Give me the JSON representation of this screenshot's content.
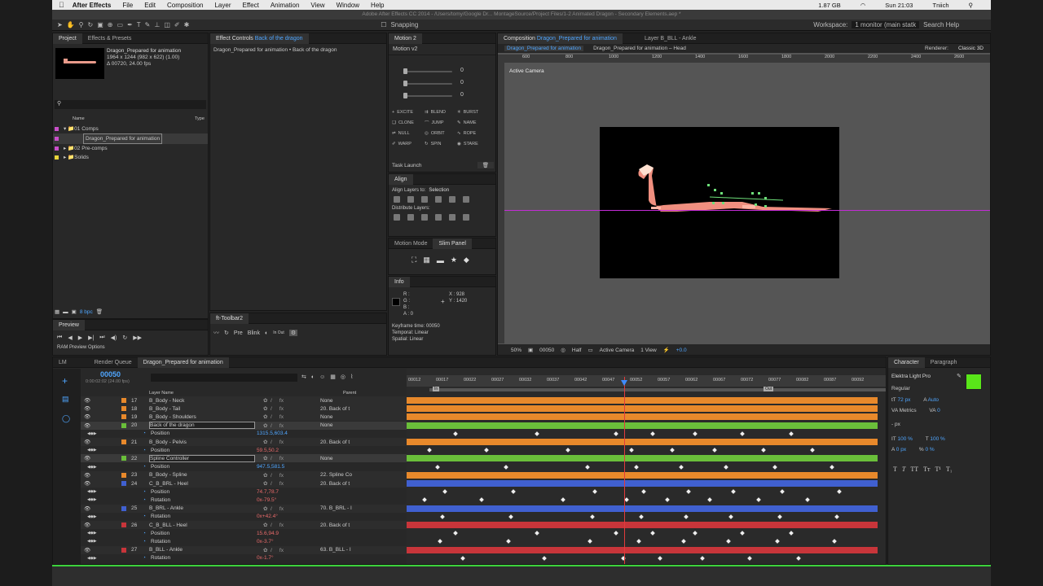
{
  "menubar": {
    "app": "After Effects",
    "items": [
      "File",
      "Edit",
      "Composition",
      "Layer",
      "Effect",
      "Animation",
      "View",
      "Window",
      "Help"
    ],
    "memory": "1.87 GB",
    "clock": "Sun 21:03",
    "user": "Tniich"
  },
  "window_title": "Adobe After Effects CC 2014 - /Users/tomy/Google Dr... MontageSource/Project Files/1-2 Animated Dragon - Secondary Elements.aep *",
  "toolbar": {
    "snapping": "Snapping",
    "workspace_label": "Workspace:",
    "workspace_value": "1 monitor (main statk",
    "search_help": "Search Help"
  },
  "project": {
    "tab1": "Project",
    "tab2": "Effects & Presets",
    "comp_name": "Dragon_Prepared for animation",
    "comp_dims": "1964 x 1244 (982 x 622) (1.00)",
    "comp_dur": "Δ 00720, 24.00 fps",
    "col_name": "Name",
    "col_type": "Type",
    "items": [
      "01 Comps",
      "Dragon_Prepared for animation",
      "02 Pre-comps",
      "Solids"
    ],
    "bpc": "8 bpc"
  },
  "effect_controls": {
    "label": "Effect Controls",
    "layer": "Back of the dragon",
    "path": "Dragon_Prepared for animation • Back of the dragon"
  },
  "motion": {
    "tab": "Motion 2",
    "version": "Motion v2",
    "vals": [
      "0",
      "0",
      "0"
    ],
    "buttons": [
      "EXCITE",
      "BLEND",
      "BURST",
      "CLONE",
      "JUMP",
      "NAME",
      "NULL",
      "ORBIT",
      "ROPE",
      "WARP",
      "SPIN",
      "STARE"
    ],
    "task": "Task Launch"
  },
  "align": {
    "tab": "Align",
    "align_to_label": "Align Layers to:",
    "align_to": "Selection",
    "distribute": "Distribute Layers:"
  },
  "motion_mode": {
    "tab1": "Motion Mode",
    "tab2": "Slim Panel"
  },
  "info": {
    "tab": "Info",
    "r": "R :",
    "g": "G :",
    "b": "B :",
    "a": "A : 0",
    "x": "X : 928",
    "y": "Y : 1420",
    "kf_time": "Keyframe time: 00050",
    "temporal": "Temporal: Linear",
    "spatial": "Spatial: Linear"
  },
  "preview": {
    "tab": "Preview",
    "ram": "RAM Preview Options"
  },
  "ft_toolbar": {
    "tab": "ft-Toolbar2",
    "pre": "Pre",
    "blink": "Blink",
    "inout": "In Out"
  },
  "composition": {
    "label": "Composition",
    "name": "Dragon_Prepared for animation",
    "layer_tab": "Layer B_BLL - Ankle",
    "crumb1": "Dragon_Prepared for animation",
    "crumb2": "Dragon_Prepared for animation – Head",
    "renderer": "Renderer:",
    "renderer_val": "Classic 3D",
    "active_camera": "Active Camera",
    "ruler": [
      "600",
      "800",
      "1000",
      "1200",
      "1400",
      "1600",
      "1800",
      "2000",
      "2200",
      "2400",
      "2600"
    ],
    "zoom": "50%",
    "time": "00050",
    "resolution": "Half",
    "camera": "Active Camera",
    "view": "1 View",
    "exposure": "+0.0"
  },
  "timeline": {
    "tab_lm": "LM",
    "tab_render": "Render Queue",
    "tab_comp": "Dragon_Prepared for animation",
    "timecode": "00050",
    "sub_time": "0:00:02:02 (24.00 fps)",
    "col_layer": "Layer Name",
    "col_parent": "Parent",
    "ruler": [
      "00012",
      "00017",
      "00022",
      "00027",
      "00032",
      "00037",
      "00042",
      "00047",
      "00052",
      "00057",
      "00062",
      "00067",
      "00072",
      "00077",
      "00082",
      "00087",
      "00092"
    ],
    "in": "In",
    "out": "Out",
    "layers": [
      {
        "num": "17",
        "name": "B_Body - Neck",
        "parent": "None",
        "color": "#e8892b",
        "kind": "layer"
      },
      {
        "num": "18",
        "name": "B_Body - Tail",
        "parent": "20. Back of t",
        "color": "#e8892b",
        "kind": "layer"
      },
      {
        "num": "19",
        "name": "B_Body - Shoulders",
        "parent": "None",
        "color": "#e8892b",
        "kind": "layer"
      },
      {
        "num": "20",
        "name": "Back of the dragon",
        "parent": "None",
        "color": "#6abf3a",
        "kind": "layer"
      },
      {
        "num": "",
        "name": "Position",
        "value": "1315.5,603.4",
        "color": "",
        "kind": "prop"
      },
      {
        "num": "21",
        "name": "B_Body - Pelvis",
        "parent": "20. Back of t",
        "color": "#e8892b",
        "kind": "layer"
      },
      {
        "num": "",
        "name": "Position",
        "value": "59.5,50.2",
        "color": "",
        "kind": "prop"
      },
      {
        "num": "22",
        "name": "Spline Controller",
        "parent": "None",
        "color": "#6abf3a",
        "kind": "layer"
      },
      {
        "num": "",
        "name": "Position",
        "value": "947.5,581.5",
        "color": "",
        "kind": "prop"
      },
      {
        "num": "23",
        "name": "B_Body - Spline",
        "parent": "22. Spline Co",
        "color": "#e8892b",
        "kind": "layer"
      },
      {
        "num": "24",
        "name": "C_B_BRL - Heel",
        "parent": "20. Back of t",
        "color": "#4060d0",
        "kind": "layer"
      },
      {
        "num": "",
        "name": "Position",
        "value": "74.7,78.7",
        "color": "",
        "kind": "prop"
      },
      {
        "num": "",
        "name": "Rotation",
        "value": "0x-79.5°",
        "color": "",
        "kind": "prop"
      },
      {
        "num": "25",
        "name": "B_BRL - Ankle",
        "parent": "70. B_BRL - I",
        "color": "#4060d0",
        "kind": "layer"
      },
      {
        "num": "",
        "name": "Rotation",
        "value": "0x+42.4°",
        "color": "",
        "kind": "prop"
      },
      {
        "num": "26",
        "name": "C_B_BLL - Heel",
        "parent": "20. Back of t",
        "color": "#c8353a",
        "kind": "layer"
      },
      {
        "num": "",
        "name": "Position",
        "value": "15.6,94.9",
        "color": "",
        "kind": "prop"
      },
      {
        "num": "",
        "name": "Rotation",
        "value": "0x-3.7°",
        "color": "",
        "kind": "prop"
      },
      {
        "num": "27",
        "name": "B_BLL - Ankle",
        "parent": "63. B_BLL - I",
        "color": "#c8353a",
        "kind": "layer"
      },
      {
        "num": "",
        "name": "Rotation",
        "value": "0x-1.7°",
        "color": "",
        "kind": "prop"
      }
    ]
  },
  "character": {
    "tab1": "Character",
    "tab2": "Paragraph",
    "font": "Elektra Light Pro",
    "style": "Regular",
    "size": "72 px",
    "leading": "Auto",
    "kerning": "Metrics",
    "tracking": "0",
    "unit": "- px",
    "vscale": "100 %",
    "hscale": "100 %",
    "baseline": "0 px",
    "tsume": "0 %",
    "fill_color": "#59e619"
  }
}
